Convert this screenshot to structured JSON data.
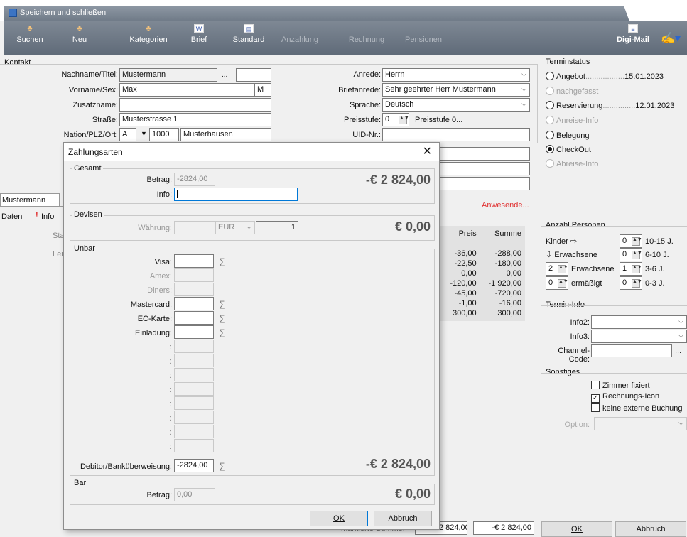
{
  "window": {
    "title": "Speichern und schließen"
  },
  "toolbar": {
    "suchen": "Suchen",
    "neu": "Neu",
    "kategorien": "Kategorien",
    "brief": "Brief",
    "standard": "Standard",
    "anzahlung": "Anzahlung",
    "rechnung": "Rechnung",
    "pensionen": "Pensionen",
    "digimail": "Digi-Mail"
  },
  "kontakt": {
    "title": "Kontakt",
    "nachname_label": "Nachname/Titel:",
    "nachname": "Mustermann",
    "titel_ellipsis": "...",
    "vorname_label": "Vorname/Sex:",
    "vorname": "Max",
    "sex": "M",
    "zusatz_label": "Zusatzname:",
    "strasse_label": "Straße:",
    "strasse": "Musterstrasse 1",
    "nation_label": "Nation/PLZ/Ort:",
    "nation": "A",
    "plz": "1000",
    "ort": "Musterhausen",
    "anrede_label": "Anrede:",
    "anrede": "Herrn",
    "briefanrede_label": "Briefanrede:",
    "briefanrede": "Sehr geehrter Herr Mustermann",
    "sprache_label": "Sprache:",
    "sprache": "Deutsch",
    "preisstufe_label": "Preisstufe:",
    "preisstufe": "0",
    "preisstufe_text": "Preisstufe 0...",
    "uid_label": "UID-Nr.:"
  },
  "terminstatus": {
    "title": "Terminstatus",
    "angebot": "Angebot",
    "angebot_date": "15.01.2023",
    "nachgefasst": "nachgefasst",
    "reservierung": "Reservierung",
    "reservierung_date": "12.01.2023",
    "anreise": "Anreise-Info",
    "belegung": "Belegung",
    "checkout": "CheckOut",
    "abreise": "Abreise-Info"
  },
  "left_tabs": {
    "mustermann": "Mustermann",
    "daten": "Daten",
    "info": "Info",
    "sta": "Sta",
    "lei": "Lei"
  },
  "anwesende": "Anwesende...",
  "grid": {
    "headers": [
      "Preis",
      "Summe"
    ],
    "rows": [
      [
        "-36,00",
        "-288,00"
      ],
      [
        "-22,50",
        "-180,00"
      ],
      [
        "0,00",
        "0,00"
      ],
      [
        "-120,00",
        "-1 920,00"
      ],
      [
        "-45,00",
        "-720,00"
      ],
      [
        "-1,00",
        "-16,00"
      ],
      [
        "300,00",
        "300,00"
      ]
    ]
  },
  "footer": {
    "label": "markierte Summe:",
    "eur": "EUR -2 824,00",
    "sum": "-€ 2 824,00",
    "ok": "OK",
    "abbruch": "Abbruch"
  },
  "personen": {
    "title": "Anzahl Personen",
    "kinder": "Kinder",
    "erw_arrow": "Erwachsene",
    "erw_val": "2",
    "erwachsene": "Erwachsene",
    "erm_val": "0",
    "ermaessigt": "ermäßigt",
    "age": [
      {
        "v": "0",
        "t": "10-15 J."
      },
      {
        "v": "0",
        "t": "6-10 J."
      },
      {
        "v": "1",
        "t": "3-6 J."
      },
      {
        "v": "0",
        "t": "0-3 J."
      }
    ]
  },
  "termininfo": {
    "title": "Termin-Info",
    "info2": "Info2:",
    "info3": "Info3:",
    "channel": "Channel-Code:",
    "ellipsis": "..."
  },
  "sonstiges": {
    "title": "Sonstiges",
    "zimmer": "Zimmer fixiert",
    "rechnung": "Rechnungs-Icon",
    "keine": "keine externe Buchung",
    "option": "Option:"
  },
  "dialog": {
    "title": "Zahlungsarten",
    "gesamt": "Gesamt",
    "betrag_label": "Betrag:",
    "betrag": "-2824,00",
    "info_label": "Info:",
    "gesamt_amount": "-€ 2 824,00",
    "devisen": "Devisen",
    "waehrung_label": "Währung:",
    "waehrung": "EUR",
    "kurs": "1",
    "devisen_amount": "€ 0,00",
    "unbar": "Unbar",
    "visa": "Visa:",
    "amex": "Amex:",
    "diners": "Diners:",
    "mastercard": "Mastercard:",
    "ec": "EC-Karte:",
    "einladung": "Einladung:",
    "debitor_label": "Debitor/Banküberweisung:",
    "debitor": "-2824,00",
    "unbar_amount": "-€ 2 824,00",
    "bar": "Bar",
    "bar_label": "Betrag:",
    "bar_betrag": "0,00",
    "bar_amount": "€ 0,00",
    "ok": "OK",
    "abbruch": "Abbruch"
  }
}
